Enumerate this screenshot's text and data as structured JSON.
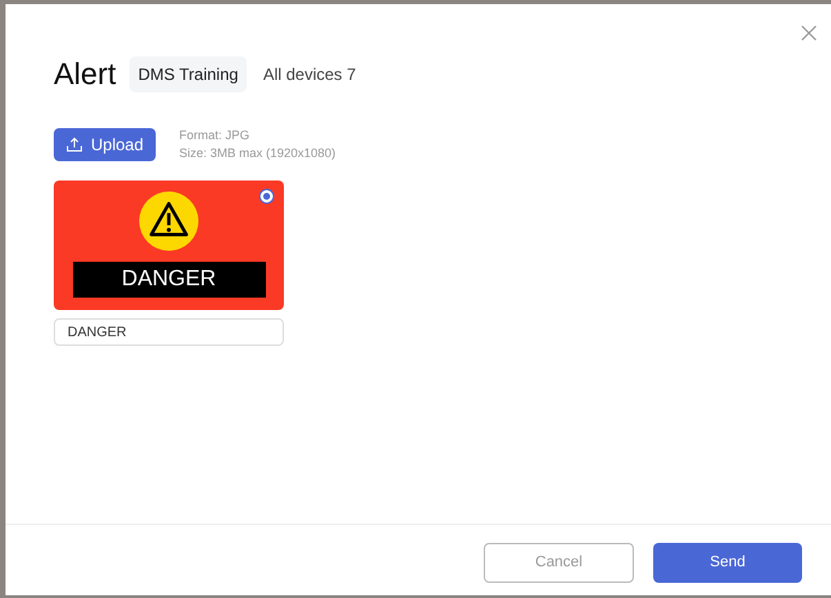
{
  "dialog": {
    "title": "Alert",
    "tag": "DMS Training",
    "devices": "All devices 7"
  },
  "upload": {
    "button": "Upload",
    "format": "Format: JPG",
    "size": "Size: 3MB max (1920x1080)"
  },
  "images": [
    {
      "caption": "DANGER",
      "name": "DANGER",
      "selected": true
    }
  ],
  "footer": {
    "cancel": "Cancel",
    "send": "Send"
  }
}
